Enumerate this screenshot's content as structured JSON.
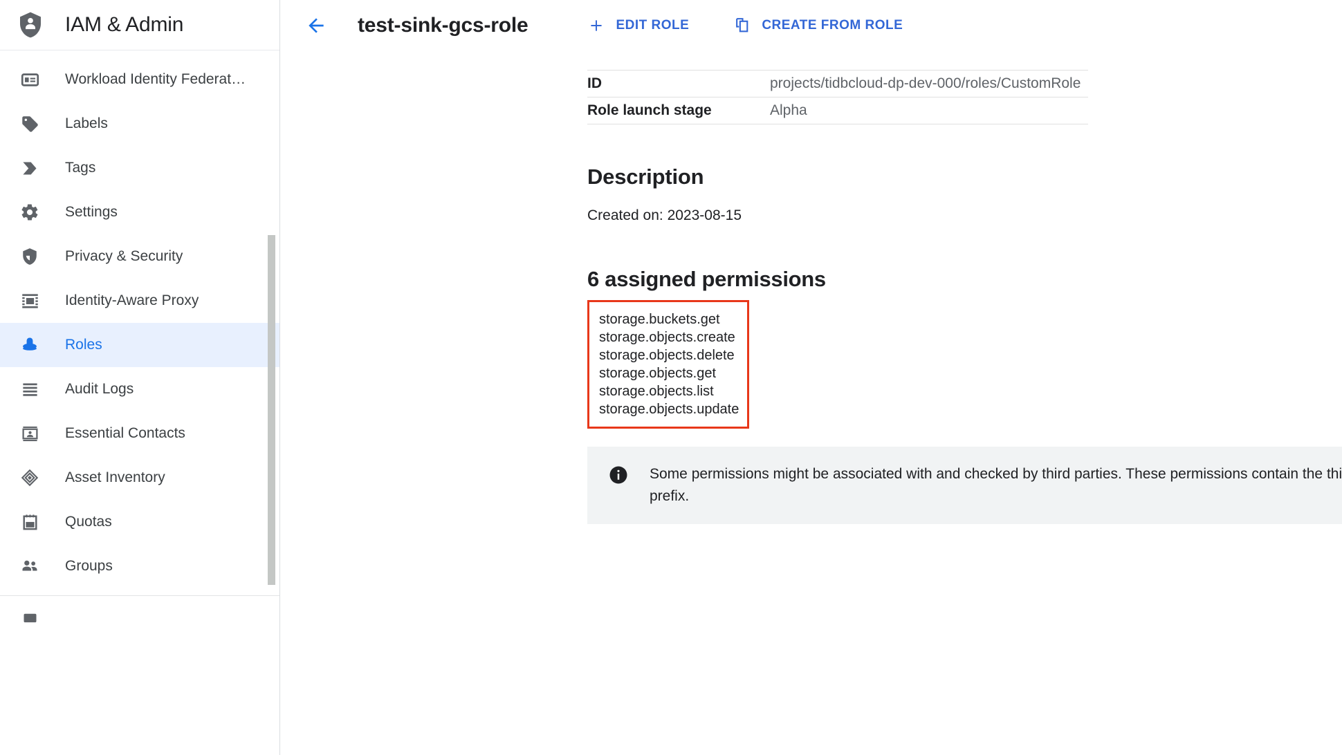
{
  "sidebar": {
    "title": "IAM & Admin",
    "logo_icon": "shield-person-icon",
    "items": [
      {
        "label": "Workload Identity Federat…",
        "icon": "badge-card-icon",
        "active": false
      },
      {
        "label": "Labels",
        "icon": "label-tag-icon",
        "active": false
      },
      {
        "label": "Tags",
        "icon": "tag-arrow-icon",
        "active": false
      },
      {
        "label": "Settings",
        "icon": "gear-icon",
        "active": false
      },
      {
        "label": "Privacy & Security",
        "icon": "shield-check-icon",
        "active": false
      },
      {
        "label": "Identity-Aware Proxy",
        "icon": "iap-proxy-icon",
        "active": false
      },
      {
        "label": "Roles",
        "icon": "hat-roles-icon",
        "active": true
      },
      {
        "label": "Audit Logs",
        "icon": "list-lines-icon",
        "active": false
      },
      {
        "label": "Essential Contacts",
        "icon": "contact-card-icon",
        "active": false
      },
      {
        "label": "Asset Inventory",
        "icon": "diamond-layers-icon",
        "active": false
      },
      {
        "label": "Quotas",
        "icon": "notepad-icon",
        "active": false
      },
      {
        "label": "Groups",
        "icon": "people-group-icon",
        "active": false
      }
    ]
  },
  "topbar": {
    "back_icon": "arrow-left-icon",
    "title": "test-sink-gcs-role",
    "actions": [
      {
        "label": "EDIT ROLE",
        "icon": "plus-icon"
      },
      {
        "label": "CREATE FROM ROLE",
        "icon": "copy-icon"
      }
    ]
  },
  "meta": {
    "rows": [
      {
        "key": "ID",
        "value": "projects/tidbcloud-dp-dev-000/roles/CustomRole"
      },
      {
        "key": "Role launch stage",
        "value": "Alpha"
      }
    ]
  },
  "description": {
    "heading": "Description",
    "text": "Created on: 2023-08-15"
  },
  "permissions": {
    "heading": "6 assigned permissions",
    "highlight_color": "#e8371a",
    "list": [
      "storage.buckets.get",
      "storage.objects.create",
      "storage.objects.delete",
      "storage.objects.get",
      "storage.objects.list",
      "storage.objects.update"
    ]
  },
  "info_banner": {
    "icon": "info-icon",
    "text": "Some permissions might be associated with and checked by third parties. These permissions contain the thir\nprefix."
  }
}
